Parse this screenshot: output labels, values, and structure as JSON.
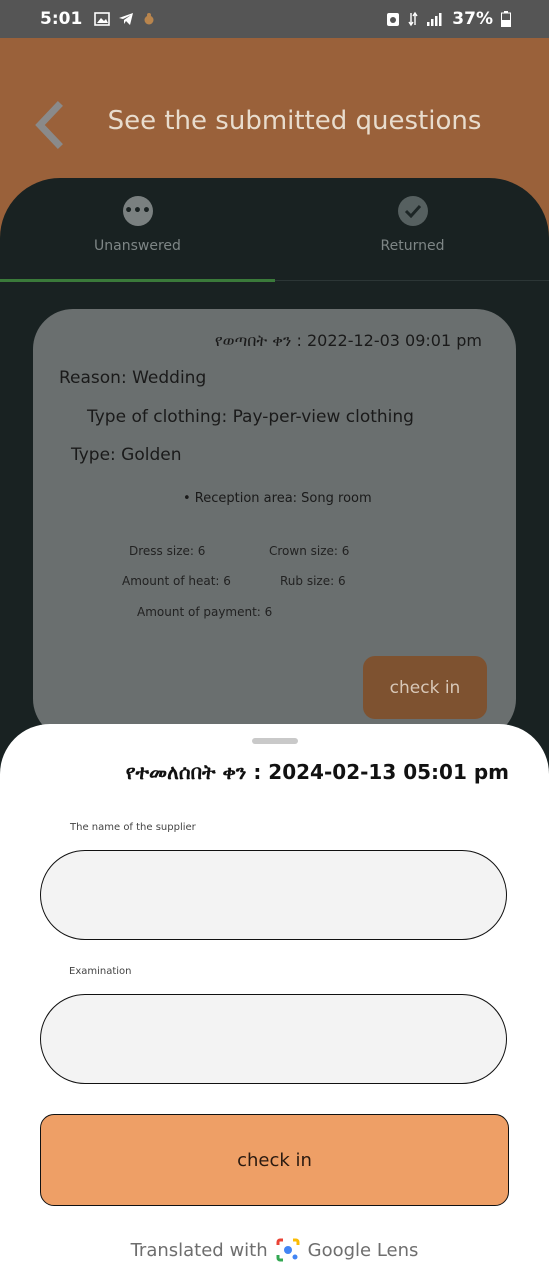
{
  "status": {
    "time": "5:01",
    "battery": "37%"
  },
  "header": {
    "title": "See the submitted questions"
  },
  "tabs": [
    {
      "label": "Unanswered",
      "icon": "more-horiz-icon",
      "selected": true
    },
    {
      "label": "Returned",
      "icon": "check-circle-icon",
      "selected": false
    }
  ],
  "card": {
    "date": "የወጣበት ቀን : 2022-12-03 09:01 pm",
    "reason": "Reason: Wedding",
    "clothing": "Type of clothing: Pay-per-view clothing",
    "type": "Type: Golden",
    "reception": "• Reception area: Song room",
    "dress_size": "Dress size: 6",
    "crown_size": "Crown size: 6",
    "amount_of_heat": "Amount of heat: 6",
    "rub_size": "Rub size: 6",
    "amount_of_payment": "Amount of payment: 6",
    "button": "check in"
  },
  "sheet": {
    "returned_date": "የተመለሰበት ቀን : 2024-02-13 05:01 pm",
    "supplier_label": "The name of the supplier",
    "supplier_value": "",
    "examination_label": "Examination",
    "examination_value": "",
    "button": "check in"
  },
  "footer": {
    "translated_with": "Translated with",
    "brand": "Google Lens"
  },
  "colors": {
    "header": "#9a613a",
    "panel": "#192222",
    "button": "#ee9f66",
    "indicator": "#3a7a3a"
  }
}
